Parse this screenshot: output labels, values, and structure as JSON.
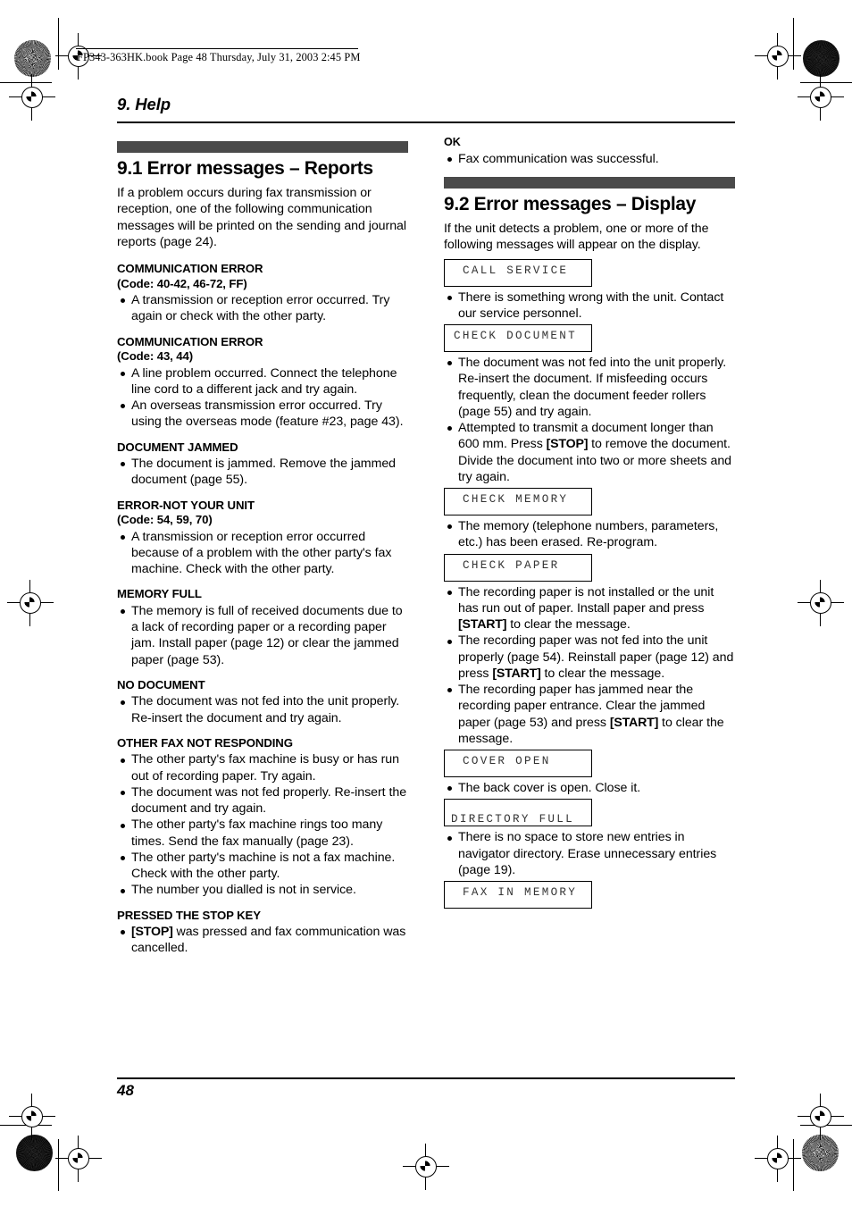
{
  "book_info": "FP343-363HK.book  Page 48  Thursday, July 31, 2003  2:45 PM",
  "chapter_title": "9. Help",
  "page_number": "48",
  "left_column": {
    "section": {
      "title": "9.1 Error messages – Reports",
      "intro": "If a problem occurs during fax transmission or reception, one of the following communication messages will be printed on the sending and journal reports (page 24)."
    },
    "entries": [
      {
        "heading": "COMMUNICATION ERROR",
        "code": "(Code: 40-42, 46-72, FF)",
        "bullets": [
          "A transmission or reception error occurred. Try again or check with the other party."
        ]
      },
      {
        "heading": "COMMUNICATION ERROR",
        "code": "(Code: 43, 44)",
        "bullets": [
          "A line problem occurred. Connect the telephone line cord to a different jack and try again.",
          "An overseas transmission error occurred. Try using the overseas mode (feature #23, page 43)."
        ]
      },
      {
        "heading": "DOCUMENT JAMMED",
        "code": "",
        "bullets": [
          "The document is jammed. Remove the jammed document (page 55)."
        ]
      },
      {
        "heading": "ERROR-NOT YOUR UNIT",
        "code": "(Code: 54, 59, 70)",
        "bullets": [
          "A transmission or reception error occurred because of a problem with the other party's fax machine. Check with the other party."
        ]
      },
      {
        "heading": "MEMORY FULL",
        "code": "",
        "bullets": [
          "The memory is full of received documents due to a lack of recording paper or a recording paper jam. Install paper (page 12) or clear the jammed paper (page 53)."
        ]
      },
      {
        "heading": "NO DOCUMENT",
        "code": "",
        "bullets": [
          "The document was not fed into the unit properly. Re-insert the document and try again."
        ]
      },
      {
        "heading": "OTHER FAX NOT RESPONDING",
        "code": "",
        "bullets": [
          "The other party's fax machine is busy or has run out of recording paper. Try again.",
          "The document was not fed properly. Re-insert the document and try again.",
          "The other party's fax machine rings too many times. Send the fax manually (page 23).",
          "The other party's machine is not a fax machine. Check with the other party.",
          "The number you dialled is not in service."
        ]
      },
      {
        "heading": "PRESSED THE STOP KEY",
        "code": "",
        "bullets": [
          "{STOP} was pressed and fax communication was cancelled."
        ]
      }
    ]
  },
  "right_column": {
    "top_entry": {
      "heading": "OK",
      "bullets": [
        "Fax communication was successful."
      ]
    },
    "section": {
      "title": "9.2 Error messages – Display",
      "intro": "If the unit detects a problem, one or more of the following messages will appear on the display."
    },
    "entries": [
      {
        "display": "CALL SERVICE",
        "display_align": "indent",
        "bullets": [
          "There is something wrong with the unit. Contact our service personnel."
        ]
      },
      {
        "display": "CHECK DOCUMENT",
        "display_align": "left",
        "bullets": [
          "The document was not fed into the unit properly. Re-insert the document. If misfeeding occurs frequently, clean the document feeder rollers (page 55) and try again.",
          "Attempted to transmit a document longer than 600 mm. Press {STOP} to remove the document. Divide the document into two or more sheets and try again."
        ]
      },
      {
        "display": "CHECK MEMORY",
        "display_align": "indent",
        "bullets": [
          "The memory (telephone numbers, parameters, etc.) has been erased. Re-program."
        ]
      },
      {
        "display": "CHECK PAPER",
        "display_align": "indent",
        "bullets": [
          "The recording paper is not installed or the unit has run out of paper. Install paper and press {START} to clear the message.",
          "The recording paper was not fed into the unit properly (page 54). Reinstall paper (page 12) and press {START} to clear the message.",
          "The recording paper has jammed near the recording paper entrance. Clear the jammed paper (page 53) and press {START} to clear the message."
        ]
      },
      {
        "display": "COVER OPEN",
        "display_align": "indent",
        "bullets": [
          "The back cover is open. Close it."
        ]
      },
      {
        "display": "DIRECTORY FULL",
        "display_align": "bottom",
        "bullets": [
          "There is no space to store new entries in navigator directory. Erase unnecessary entries (page 19)."
        ]
      },
      {
        "display": "FAX IN MEMORY",
        "display_align": "indent",
        "bullets": []
      }
    ]
  },
  "colors": {
    "section_bar": "#4a4a4a",
    "lcd_text": "#333333",
    "text": "#000000"
  }
}
